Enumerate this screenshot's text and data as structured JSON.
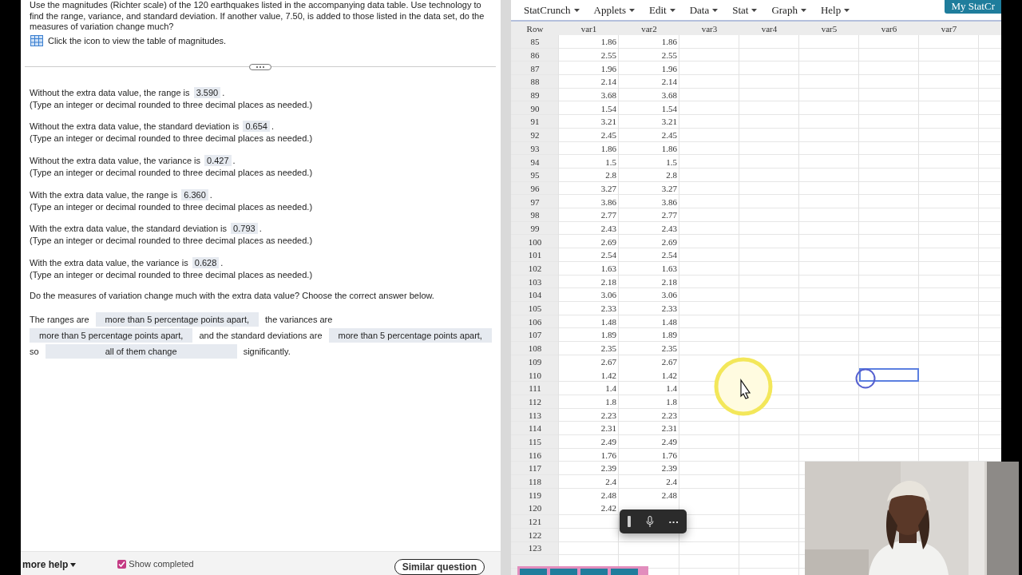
{
  "question": {
    "prompt": "Use the magnitudes (Richter scale) of the 120 earthquakes listed in the accompanying data table. Use technology to find the range, variance, and standard deviation. If another value, 7.50, is added to those listed in the data set, do the measures of variation change much?",
    "table_link": "Click the icon to view the table of magnitudes."
  },
  "answers": [
    {
      "before": "Without the extra data value, the range is",
      "value": "3.590",
      "after": ".",
      "hint": "(Type an integer or decimal rounded to three decimal places as needed.)"
    },
    {
      "before": "Without the extra data value, the standard deviation is",
      "value": "0.654",
      "after": ".",
      "hint": "(Type an integer or decimal rounded to three decimal places as needed.)"
    },
    {
      "before": "Without the extra data value, the variance is",
      "value": "0.427",
      "after": ".",
      "hint": "(Type an integer or decimal rounded to three decimal places as needed.)"
    },
    {
      "before": "With the extra data value, the range is",
      "value": "6.360",
      "after": ".",
      "hint": "(Type an integer or decimal rounded to three decimal places as needed.)"
    },
    {
      "before": "With the extra data value, the standard deviation is",
      "value": "0.793",
      "after": ".",
      "hint": "(Type an integer or decimal rounded to three decimal places as needed.)"
    },
    {
      "before": "With the extra data value, the variance is",
      "value": "0.628",
      "after": ".",
      "hint": "(Type an integer or decimal rounded to three decimal places as needed.)"
    }
  ],
  "followup": "Do the measures of variation change much with the extra data value? Choose the correct answer below.",
  "choice_lines": [
    [
      {
        "kind": "text",
        "text": "The ranges are"
      },
      {
        "kind": "choice",
        "text": "more than 5 percentage points apart,"
      },
      {
        "kind": "text",
        "text": "the variances are"
      }
    ],
    [
      {
        "kind": "choice",
        "text": "more than 5 percentage points apart,"
      },
      {
        "kind": "text",
        "text": "and the standard deviations are"
      },
      {
        "kind": "choice",
        "text": "more than 5 percentage points apart,"
      }
    ],
    [
      {
        "kind": "text",
        "text": "so"
      },
      {
        "kind": "choice",
        "text": "all of them change"
      },
      {
        "kind": "text",
        "text": "significantly."
      }
    ]
  ],
  "footer": {
    "help": "more help",
    "show_completed": {
      "label": "Show completed",
      "checked": true
    },
    "similar": "Similar question"
  },
  "statcrunch": {
    "menus": [
      "StatCrunch",
      "Applets",
      "Edit",
      "Data",
      "Stat",
      "Graph",
      "Help"
    ],
    "account_button": "My StatCr",
    "columns": [
      "Row",
      "var1",
      "var2",
      "var3",
      "var4",
      "var5",
      "var6",
      "var7"
    ],
    "rows": [
      {
        "row": "85",
        "var1": "1.86",
        "var2": "1.86",
        "cell_selected": [
          false,
          false,
          false,
          false,
          false,
          false,
          false
        ]
      },
      {
        "row": "86",
        "var1": "2.55",
        "var2": "2.55",
        "cell_selected": [
          false,
          false,
          false,
          false,
          false,
          false,
          false
        ]
      },
      {
        "row": "87",
        "var1": "1.96",
        "var2": "1.96",
        "cell_selected": [
          false,
          false,
          false,
          false,
          false,
          false,
          false
        ]
      },
      {
        "row": "88",
        "var1": "2.14",
        "var2": "2.14",
        "cell_selected": [
          false,
          false,
          false,
          false,
          false,
          false,
          false
        ]
      },
      {
        "row": "89",
        "var1": "3.68",
        "var2": "3.68",
        "cell_selected": [
          false,
          false,
          false,
          false,
          false,
          false,
          false
        ]
      },
      {
        "row": "90",
        "var1": "1.54",
        "var2": "1.54",
        "cell_selected": [
          false,
          false,
          false,
          false,
          false,
          false,
          false
        ]
      },
      {
        "row": "91",
        "var1": "3.21",
        "var2": "3.21",
        "cell_selected": [
          false,
          false,
          false,
          false,
          false,
          false,
          false
        ]
      },
      {
        "row": "92",
        "var1": "2.45",
        "var2": "2.45",
        "cell_selected": [
          false,
          false,
          false,
          false,
          false,
          false,
          false
        ]
      },
      {
        "row": "93",
        "var1": "1.86",
        "var2": "1.86",
        "cell_selected": [
          false,
          false,
          false,
          false,
          false,
          false,
          false
        ]
      },
      {
        "row": "94",
        "var1": "1.5",
        "var2": "1.5",
        "cell_selected": [
          false,
          false,
          false,
          false,
          false,
          false,
          false
        ]
      },
      {
        "row": "95",
        "var1": "2.8",
        "var2": "2.8",
        "cell_selected": [
          false,
          false,
          false,
          false,
          false,
          false,
          false
        ]
      },
      {
        "row": "96",
        "var1": "3.27",
        "var2": "3.27",
        "cell_selected": [
          false,
          false,
          false,
          false,
          false,
          false,
          false
        ]
      },
      {
        "row": "97",
        "var1": "3.86",
        "var2": "3.86",
        "cell_selected": [
          false,
          false,
          false,
          false,
          false,
          false,
          false
        ]
      },
      {
        "row": "98",
        "var1": "2.77",
        "var2": "2.77",
        "cell_selected": [
          false,
          false,
          false,
          false,
          false,
          false,
          false
        ]
      },
      {
        "row": "99",
        "var1": "2.43",
        "var2": "2.43",
        "cell_selected": [
          false,
          false,
          false,
          false,
          false,
          false,
          false
        ]
      },
      {
        "row": "100",
        "var1": "2.69",
        "var2": "2.69",
        "cell_selected": [
          false,
          false,
          false,
          false,
          false,
          false,
          false
        ]
      },
      {
        "row": "101",
        "var1": "2.54",
        "var2": "2.54",
        "cell_selected": [
          false,
          false,
          false,
          false,
          false,
          false,
          false
        ]
      },
      {
        "row": "102",
        "var1": "1.63",
        "var2": "1.63",
        "cell_selected": [
          false,
          false,
          false,
          false,
          false,
          false,
          false
        ]
      },
      {
        "row": "103",
        "var1": "2.18",
        "var2": "2.18",
        "cell_selected": [
          false,
          false,
          false,
          false,
          false,
          false,
          false
        ]
      },
      {
        "row": "104",
        "var1": "3.06",
        "var2": "3.06",
        "cell_selected": [
          false,
          false,
          false,
          false,
          false,
          false,
          false
        ]
      },
      {
        "row": "105",
        "var1": "2.33",
        "var2": "2.33",
        "cell_selected": [
          false,
          false,
          false,
          false,
          false,
          false,
          false
        ]
      },
      {
        "row": "106",
        "var1": "1.48",
        "var2": "1.48",
        "cell_selected": [
          false,
          false,
          false,
          false,
          false,
          false,
          false
        ]
      },
      {
        "row": "107",
        "var1": "1.89",
        "var2": "1.89",
        "cell_selected": [
          false,
          false,
          false,
          false,
          false,
          false,
          false
        ]
      },
      {
        "row": "108",
        "var1": "2.35",
        "var2": "2.35",
        "cell_selected": [
          false,
          false,
          false,
          false,
          false,
          false,
          false
        ]
      },
      {
        "row": "109",
        "var1": "2.67",
        "var2": "2.67",
        "cell_selected": [
          false,
          false,
          false,
          false,
          false,
          false,
          false
        ]
      },
      {
        "row": "110",
        "var1": "1.42",
        "var2": "1.42",
        "cell_selected": [
          false,
          false,
          false,
          false,
          false,
          true,
          false
        ]
      },
      {
        "row": "111",
        "var1": "1.4",
        "var2": "1.4",
        "cell_selected": [
          false,
          false,
          false,
          false,
          false,
          false,
          false
        ]
      },
      {
        "row": "112",
        "var1": "1.8",
        "var2": "1.8",
        "cell_selected": [
          false,
          false,
          false,
          false,
          false,
          false,
          false
        ]
      },
      {
        "row": "113",
        "var1": "2.23",
        "var2": "2.23",
        "cell_selected": [
          false,
          false,
          false,
          false,
          false,
          false,
          false
        ]
      },
      {
        "row": "114",
        "var1": "2.31",
        "var2": "2.31",
        "cell_selected": [
          false,
          false,
          false,
          false,
          false,
          false,
          false
        ]
      },
      {
        "row": "115",
        "var1": "2.49",
        "var2": "2.49",
        "cell_selected": [
          false,
          false,
          false,
          false,
          false,
          false,
          false
        ]
      },
      {
        "row": "116",
        "var1": "1.76",
        "var2": "1.76",
        "cell_selected": [
          false,
          false,
          false,
          false,
          false
        ]
      },
      {
        "row": "117",
        "var1": "2.39",
        "var2": "2.39",
        "cell_selected": [
          false,
          false,
          false,
          false,
          false
        ]
      },
      {
        "row": "118",
        "var1": "2.4",
        "var2": "2.4",
        "cell_selected": [
          false,
          false,
          false,
          false,
          false
        ]
      },
      {
        "row": "119",
        "var1": "2.48",
        "var2": "2.48",
        "cell_selected": [
          false,
          false,
          false,
          false,
          false
        ]
      },
      {
        "row": "120",
        "var1": "2.42",
        "cell_selected": [
          false,
          false,
          false,
          false,
          false
        ]
      },
      {
        "row": "121",
        "cell_selected": [
          false,
          false,
          false,
          false,
          false
        ]
      },
      {
        "row": "122",
        "cell_selected": [
          false,
          false,
          false,
          false,
          false
        ]
      },
      {
        "row": "123",
        "cell_selected": [
          false,
          false,
          false,
          false,
          false
        ]
      }
    ]
  },
  "recorder": {
    "more": "···"
  }
}
